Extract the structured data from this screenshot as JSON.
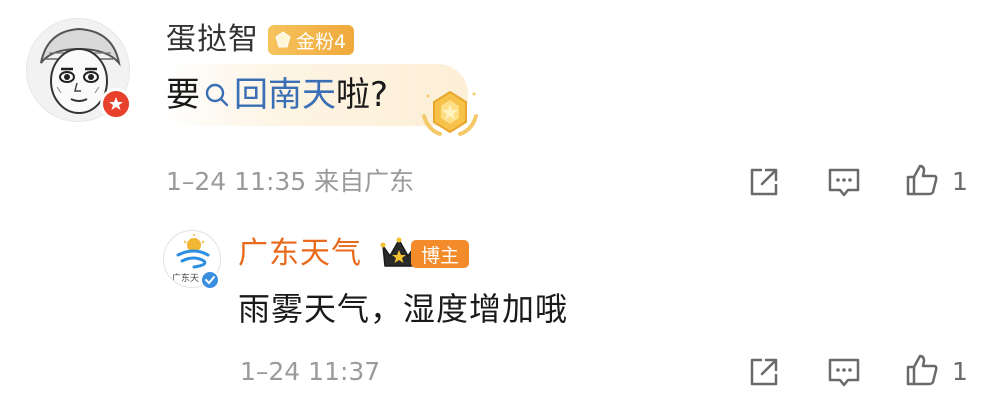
{
  "comment": {
    "username": "蛋挞智",
    "fan_badge": "金粉4",
    "text_before": "要",
    "topic": "回南天",
    "text_after": "啦?",
    "meta": "1–24 11:35 来自广东",
    "like_count": "1"
  },
  "reply": {
    "avatar_text": "广东天",
    "username": "广东天气",
    "role_badge": "博主",
    "text": "雨雾天气，湿度增加哦",
    "meta": "1–24 11:37",
    "like_count": "1"
  },
  "icons": {
    "share": "share-icon",
    "comment": "comment-icon",
    "like": "thumbs-up-icon"
  },
  "colors": {
    "topic_link": "#3a6fb5",
    "reply_name": "#e86a1c",
    "blogger_badge": "#f38b2b",
    "fan_badge": "#f0a93c",
    "meta_text": "#9a9a9a"
  }
}
